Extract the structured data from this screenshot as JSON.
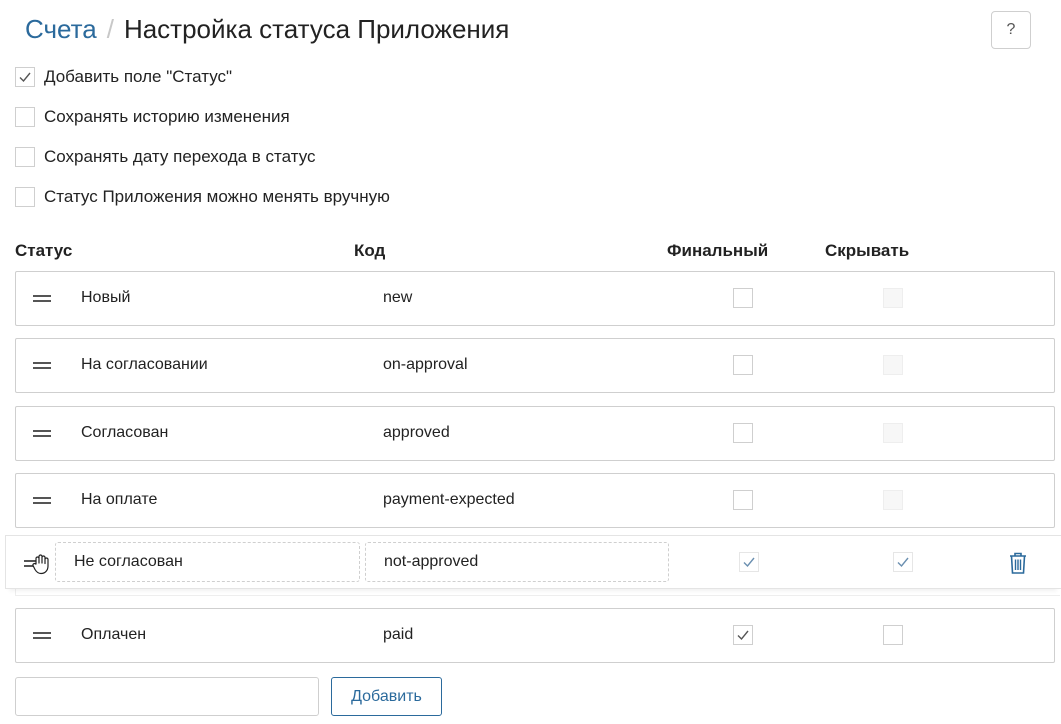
{
  "breadcrumb": {
    "parent": "Счета",
    "separator": "/",
    "title": "Настройка статуса Приложения"
  },
  "help": {
    "label": "?"
  },
  "options": [
    {
      "label": "Добавить поле \"Статус\"",
      "checked": true
    },
    {
      "label": "Сохранять историю изменения",
      "checked": false
    },
    {
      "label": "Сохранять дату перехода в статус",
      "checked": false
    },
    {
      "label": "Статус Приложения можно менять вручную",
      "checked": false
    }
  ],
  "columns": {
    "status": "Статус",
    "code": "Код",
    "final": "Финальный",
    "hide": "Скрывать"
  },
  "rows": [
    {
      "name": "Новый",
      "code": "new",
      "final": false,
      "hide": false,
      "hide_disabled": true
    },
    {
      "name": "На согласовании",
      "code": "on-approval",
      "final": false,
      "hide": false,
      "hide_disabled": true
    },
    {
      "name": "Согласован",
      "code": "approved",
      "final": false,
      "hide": false,
      "hide_disabled": true
    },
    {
      "name": "На оплате",
      "code": "payment-expected",
      "final": false,
      "hide": false,
      "hide_disabled": true
    }
  ],
  "dragging_row": {
    "name": "Не согласован",
    "code": "not-approved",
    "final": true,
    "hide": true
  },
  "last_row": {
    "name": "Оплачен",
    "code": "paid",
    "final": true,
    "hide": false
  },
  "new_status": {
    "value": "",
    "placeholder": ""
  },
  "add_button": {
    "label": "Добавить"
  },
  "colors": {
    "link": "#2b6a9c",
    "border": "#cfcfcf"
  }
}
